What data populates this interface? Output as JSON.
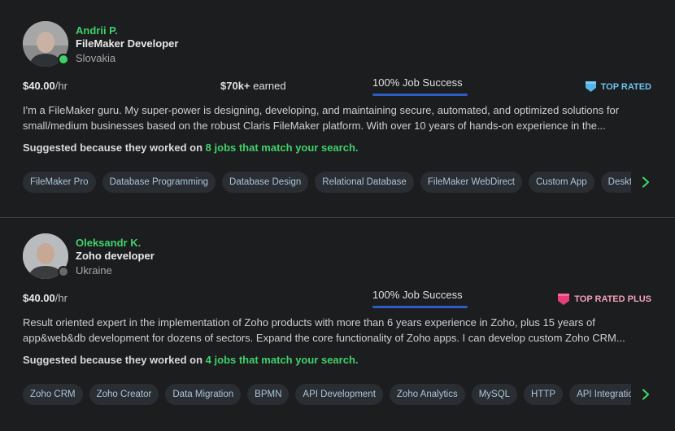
{
  "freelancers": [
    {
      "name": "Andrii P.",
      "title": "FileMaker Developer",
      "country": "Slovakia",
      "rate_amount": "$40.00",
      "rate_unit": "/hr",
      "earned_amount": "$70k+",
      "earned_label": " earned",
      "job_success": "100% Job Success",
      "badge": "TOP RATED",
      "badge_icon": "shield-top-rated-icon",
      "status": "online",
      "description_line1": "I'm a FileMaker guru. My super-power is designing, developing, and maintaining secure, automated, and optimized solutions for",
      "description_line2": "small/medium businesses based on the robust Claris FileMaker platform. With over 10 years of hands-on experience in the...",
      "suggest_prefix": "Suggested because they worked on ",
      "suggest_match": "8 jobs that match your search.",
      "skills": [
        "FileMaker Pro",
        "Database Programming",
        "Database Design",
        "Relational Database",
        "FileMaker WebDirect",
        "Custom App",
        "Desktop Application"
      ]
    },
    {
      "name": "Oleksandr K.",
      "title": "Zoho developer",
      "country": "Ukraine",
      "rate_amount": "$40.00",
      "rate_unit": "/hr",
      "job_success": "100% Job Success",
      "badge": "TOP RATED PLUS",
      "badge_icon": "shield-top-rated-plus-icon",
      "status": "offline",
      "description_line1": "Result oriented expert in the implementation of Zoho products with more than 6 years experience in Zoho, plus 15 years of",
      "description_line2": "app&web&db development for dozens of sectors. Expand the core functionality of Zoho apps. I can develop custom Zoho CRM...",
      "suggest_prefix": "Suggested because they worked on ",
      "suggest_match": "4 jobs that match your search.",
      "skills": [
        "Zoho CRM",
        "Zoho Creator",
        "Data Migration",
        "BPMN",
        "API Development",
        "Zoho Analytics",
        "MySQL",
        "HTTP",
        "API Integration"
      ]
    }
  ],
  "colors": {
    "accent_green": "#3fd26a",
    "job_success_bar": "#2f5cc5",
    "top_rated_blue": "#6bc3ee",
    "top_rated_plus_pink": "#f2a0b8"
  },
  "icons": {
    "next": "chevron-right-icon"
  }
}
